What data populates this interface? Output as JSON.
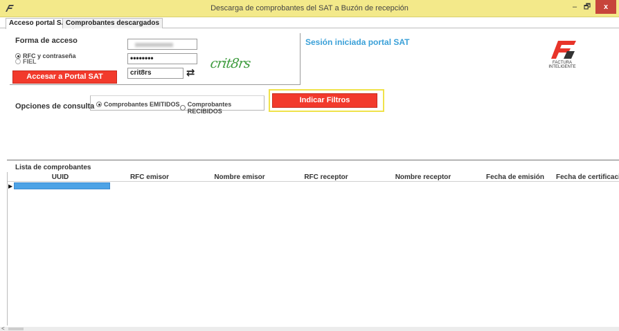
{
  "window": {
    "title": "Descarga de comprobantes del SAT a Buzón de recepción",
    "minimize": "–",
    "maximize": "🗗",
    "close": "x"
  },
  "tabs": [
    {
      "label": "Acceso portal SAT",
      "active": true
    },
    {
      "label": "Comprobantes descargados",
      "active": false
    }
  ],
  "login": {
    "section_label": "Forma de acceso",
    "access_options": [
      {
        "label": "RFC y contraseña",
        "selected": true
      },
      {
        "label": "FIEL",
        "selected": false
      }
    ],
    "password_value": "••••••••",
    "captcha_value": "crit8rs",
    "captcha_image_text": "crit8rs",
    "access_button": "Accesar a Portal SAT"
  },
  "session": {
    "status": "Sesión iniciada portal SAT"
  },
  "brand": {
    "logo_text": "FACTURA INTELIGENTE",
    "accent": "#e8342a"
  },
  "options": {
    "label": "Opciones de consulta",
    "choices": [
      {
        "label": "Comprobantes EMITIDOS",
        "selected": true
      },
      {
        "label": "Comprobantes RECIBIDOS",
        "selected": false
      }
    ],
    "filter_button": "Indicar Filtros"
  },
  "list": {
    "label": "Lista de comprobantes",
    "columns": [
      "UUID",
      "RFC emisor",
      "Nombre emisor",
      "RFC receptor",
      "Nombre receptor",
      "Fecha de emisión",
      "Fecha de certificación"
    ],
    "row_marker": "▶"
  },
  "colors": {
    "title_bar": "#f3e98a",
    "red_button": "#f23a2c",
    "session_text": "#3aa0d8",
    "highlight": "#f0e24a",
    "selected_cell": "#4da3e6"
  }
}
